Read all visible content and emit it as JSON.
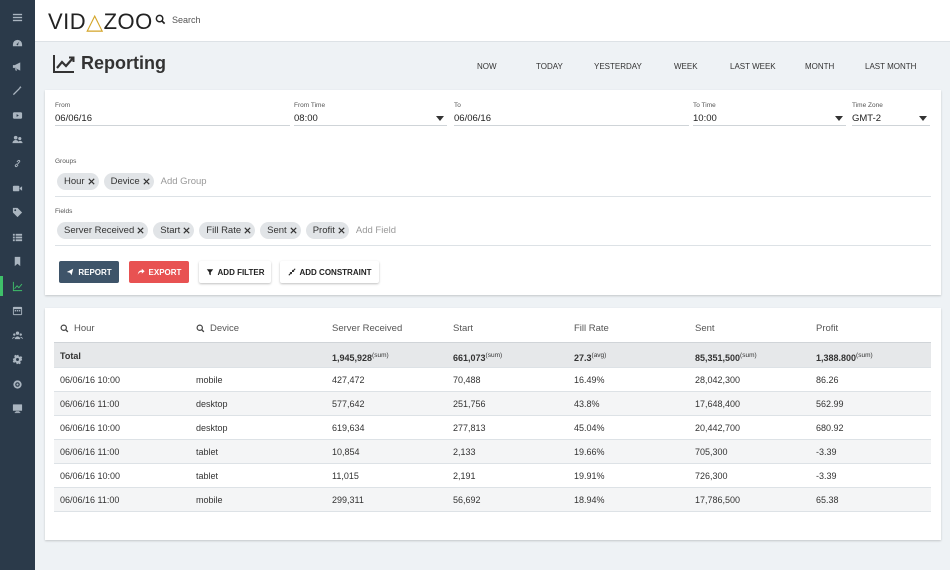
{
  "app": {
    "logo_left": "VID",
    "logo_mark": "△",
    "logo_right": "ZOO"
  },
  "search": {
    "label": "Search"
  },
  "page": {
    "title": "Reporting"
  },
  "sidebar": {
    "items": [
      {
        "icon": "menu-icon"
      },
      {
        "icon": "dashboard-icon"
      },
      {
        "icon": "megaphone-icon"
      },
      {
        "icon": "magic-wand-icon"
      },
      {
        "icon": "video-icon"
      },
      {
        "icon": "users-group-icon"
      },
      {
        "icon": "link-icon"
      },
      {
        "icon": "camera-icon"
      },
      {
        "icon": "tag-icon"
      },
      {
        "icon": "list-icon"
      },
      {
        "icon": "bookmark-icon"
      },
      {
        "icon": "line-chart-icon",
        "active": true
      },
      {
        "icon": "calendar-icon"
      },
      {
        "icon": "team-icon"
      },
      {
        "icon": "gear-icon"
      },
      {
        "icon": "circle-icon"
      },
      {
        "icon": "monitor-icon"
      }
    ],
    "active_color": "#3fc06a"
  },
  "ranges": [
    "NOW",
    "TODAY",
    "YESTERDAY",
    "WEEK",
    "LAST WEEK",
    "MONTH",
    "LAST MONTH"
  ],
  "filters": {
    "from": {
      "label": "From",
      "value": "06/06/16"
    },
    "from_time": {
      "label": "From Time",
      "value": "08:00"
    },
    "to": {
      "label": "To",
      "value": "06/06/16"
    },
    "to_time": {
      "label": "To Time",
      "value": "10:00"
    },
    "time_zone": {
      "label": "Time Zone",
      "value": "GMT-2"
    },
    "groups": {
      "label": "Groups",
      "chips": [
        "Hour",
        "Device"
      ],
      "add_label": "Add Group"
    },
    "fields": {
      "label": "Fields",
      "chips": [
        "Server Received",
        "Start",
        "Fill Rate",
        "Sent",
        "Profit"
      ],
      "add_label": "Add Field"
    }
  },
  "actions": {
    "report": "REPORT",
    "export": "EXPORT",
    "add_filter": "ADD FILTER",
    "add_constraint": "ADD CONSTRAINT"
  },
  "colors": {
    "report_button": "#3e5469",
    "export_button": "#e85252",
    "sidebar_bg": "#2b3a4a"
  },
  "table": {
    "headers": [
      "Hour",
      "Device",
      "Server Received",
      "Start",
      "Fill Rate",
      "Sent",
      "Profit"
    ],
    "total": {
      "label": "Total",
      "server_received": "1,945,928",
      "server_received_agg": "(sum)",
      "start": "661,073",
      "start_agg": "(sum)",
      "fill_rate": "27.3",
      "fill_rate_agg": "(avg)",
      "sent": "85,351,500",
      "sent_agg": "(sum)",
      "profit": "1,388.800",
      "profit_agg": "(sum)"
    },
    "rows": [
      [
        "06/06/16 10:00",
        "mobile",
        "427,472",
        "70,488",
        "16.49%",
        "28,042,300",
        "86.26"
      ],
      [
        "06/06/16 11:00",
        "desktop",
        "577,642",
        "251,756",
        "43.8%",
        "17,648,400",
        "562.99"
      ],
      [
        "06/06/16 10:00",
        "desktop",
        "619,634",
        "277,813",
        "45.04%",
        "20,442,700",
        "680.92"
      ],
      [
        "06/06/16 11:00",
        "tablet",
        "10,854",
        "2,133",
        "19.66%",
        "705,300",
        "-3.39"
      ],
      [
        "06/06/16 10:00",
        "tablet",
        "11,015",
        "2,191",
        "19.91%",
        "726,300",
        "-3.39"
      ],
      [
        "06/06/16 11:00",
        "mobile",
        "299,311",
        "56,692",
        "18.94%",
        "17,786,500",
        "65.38"
      ]
    ]
  }
}
